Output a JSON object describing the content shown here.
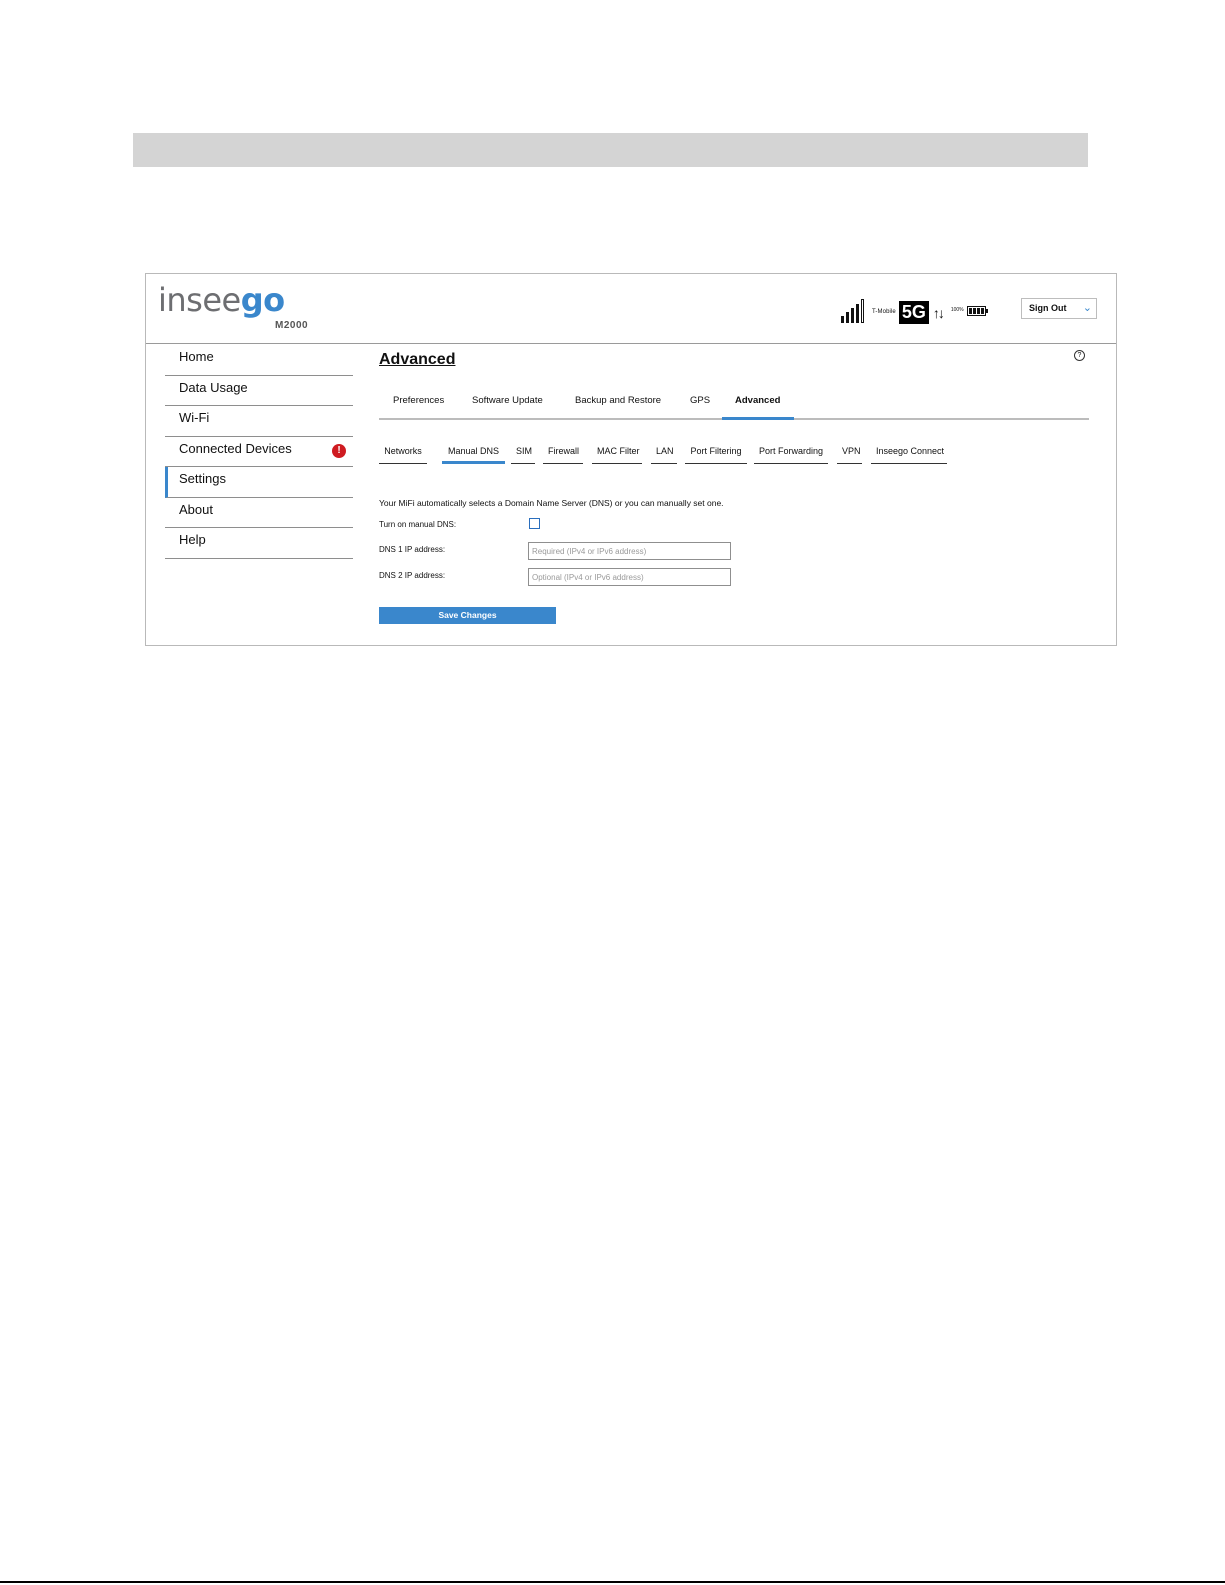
{
  "header": {
    "logo_primary": "insee",
    "logo_accent": "go",
    "model": "M2000",
    "carrier": "T-Mobile",
    "network_type": "5G",
    "data_arrows": "↑↓",
    "battery_percent": "100%",
    "signal_bars": 5,
    "signout_label": "Sign Out"
  },
  "sidebar": {
    "items": [
      {
        "label": "Home"
      },
      {
        "label": "Data Usage"
      },
      {
        "label": "Wi-Fi"
      },
      {
        "label": "Connected Devices",
        "badge": "!"
      },
      {
        "label": "Settings",
        "active": true
      },
      {
        "label": "About"
      },
      {
        "label": "Help"
      }
    ]
  },
  "main": {
    "title": "Advanced",
    "help_glyph": "?",
    "tabs": [
      "Preferences",
      "Software Update",
      "Backup and Restore",
      "GPS",
      "Advanced"
    ],
    "active_tab": "Advanced",
    "subtabs": [
      "Networks",
      "Manual DNS",
      "SIM",
      "Firewall",
      "MAC Filter",
      "LAN",
      "Port Filtering",
      "Port Forwarding",
      "VPN",
      "Inseego Connect"
    ],
    "active_subtab": "Manual DNS",
    "description": "Your MiFi automatically selects a Domain Name Server (DNS) or you can manually set one.",
    "manual_dns_label": "Turn on manual DNS:",
    "manual_dns_checked": false,
    "dns1_label": "DNS 1 IP address:",
    "dns1_placeholder": "Required (IPv4 or IPv6 address)",
    "dns2_label": "DNS 2 IP address:",
    "dns2_placeholder": "Optional (IPv4 or IPv6 address)",
    "save_label": "Save Changes"
  },
  "colors": {
    "accent": "#3a87cc",
    "badge": "#cf1b21",
    "logo_gray": "#6d6e71"
  }
}
